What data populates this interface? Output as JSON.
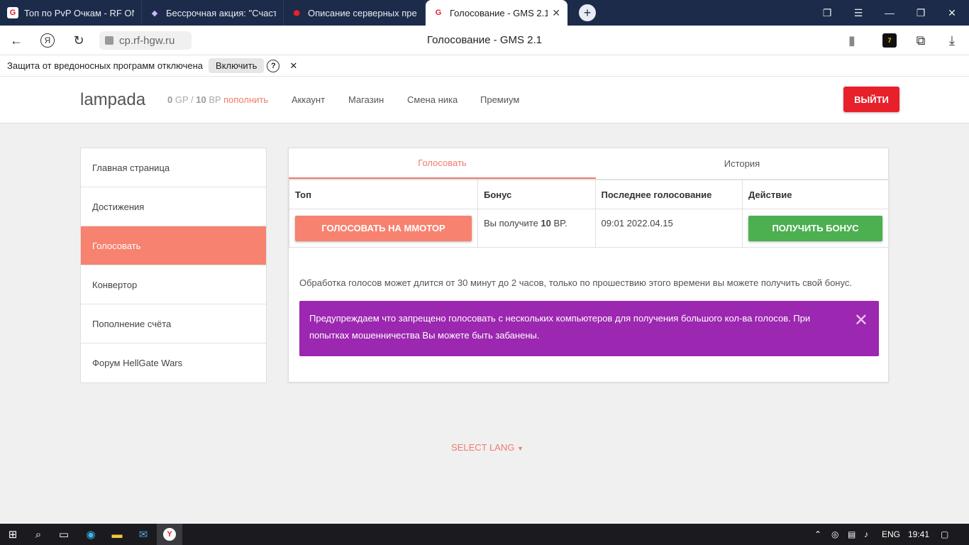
{
  "browser": {
    "tabs": [
      {
        "label": "Топ по PvP Очкам - RF ON",
        "icon": "gms-g-icon"
      },
      {
        "label": "Бессрочная акция: \"Счаст",
        "icon": "gem-icon"
      },
      {
        "label": "Описание серверных пре",
        "icon": "cube-icon"
      },
      {
        "label": "Голосование - GMS 2.1",
        "icon": "gms-g-icon",
        "active": true
      }
    ],
    "new_tab": "+",
    "url": "cp.rf-hgw.ru",
    "page_title": "Голосование - GMS 2.1",
    "protection": {
      "text": "Защита от вредоносных программ отключена",
      "enable_label": "Включить",
      "help": "?",
      "close": "✕"
    }
  },
  "header": {
    "brand": "lampada",
    "gp_value": "0",
    "gp_unit": "GP",
    "separator": "/",
    "bp_value": "10",
    "bp_unit": "BP",
    "topup": "пополнить",
    "nav": [
      "Аккаунт",
      "Магазин",
      "Смена ника",
      "Премиум"
    ],
    "logout": "ВЫЙТИ"
  },
  "sidebar": {
    "items": [
      {
        "label": "Главная страница"
      },
      {
        "label": "Достижения"
      },
      {
        "label": "Голосовать",
        "active": true
      },
      {
        "label": "Конвертор"
      },
      {
        "label": "Пополнение счёта"
      },
      {
        "label": "Форум HellGate Wars"
      }
    ]
  },
  "main": {
    "tabs": [
      "Голосовать",
      "История"
    ],
    "table": {
      "headers": [
        "Топ",
        "Бонус",
        "Последнее голосование",
        "Действие"
      ],
      "row": {
        "vote_button": "ГОЛОСОВАТЬ НА ММОТОР",
        "bonus_prefix": "Вы получите",
        "bonus_value": "10",
        "bonus_suffix": "BP.",
        "last_vote": "09:01 2022.04.15",
        "bonus_button": "ПОЛУЧИТЬ БОНУС"
      }
    },
    "note": "Обработка голосов может длится от 30 минут до 2 часов, только по прошествию этого времени вы можете получить свой бонус.",
    "warning": "Предупреждаем что запрещено голосовать с нескольких компьютеров для получения большого кол-ва голосов. При попытках мошенничества Вы можете быть забанены."
  },
  "footer": {
    "select_lang": "SELECT LANG"
  },
  "taskbar": {
    "lang": "ENG",
    "time": "19:41"
  },
  "colors": {
    "accent": "#f7826f",
    "logout": "#e8202a",
    "bonus": "#4caf50",
    "warning": "#9c27b0",
    "tabbar": "#1c2b4a"
  }
}
